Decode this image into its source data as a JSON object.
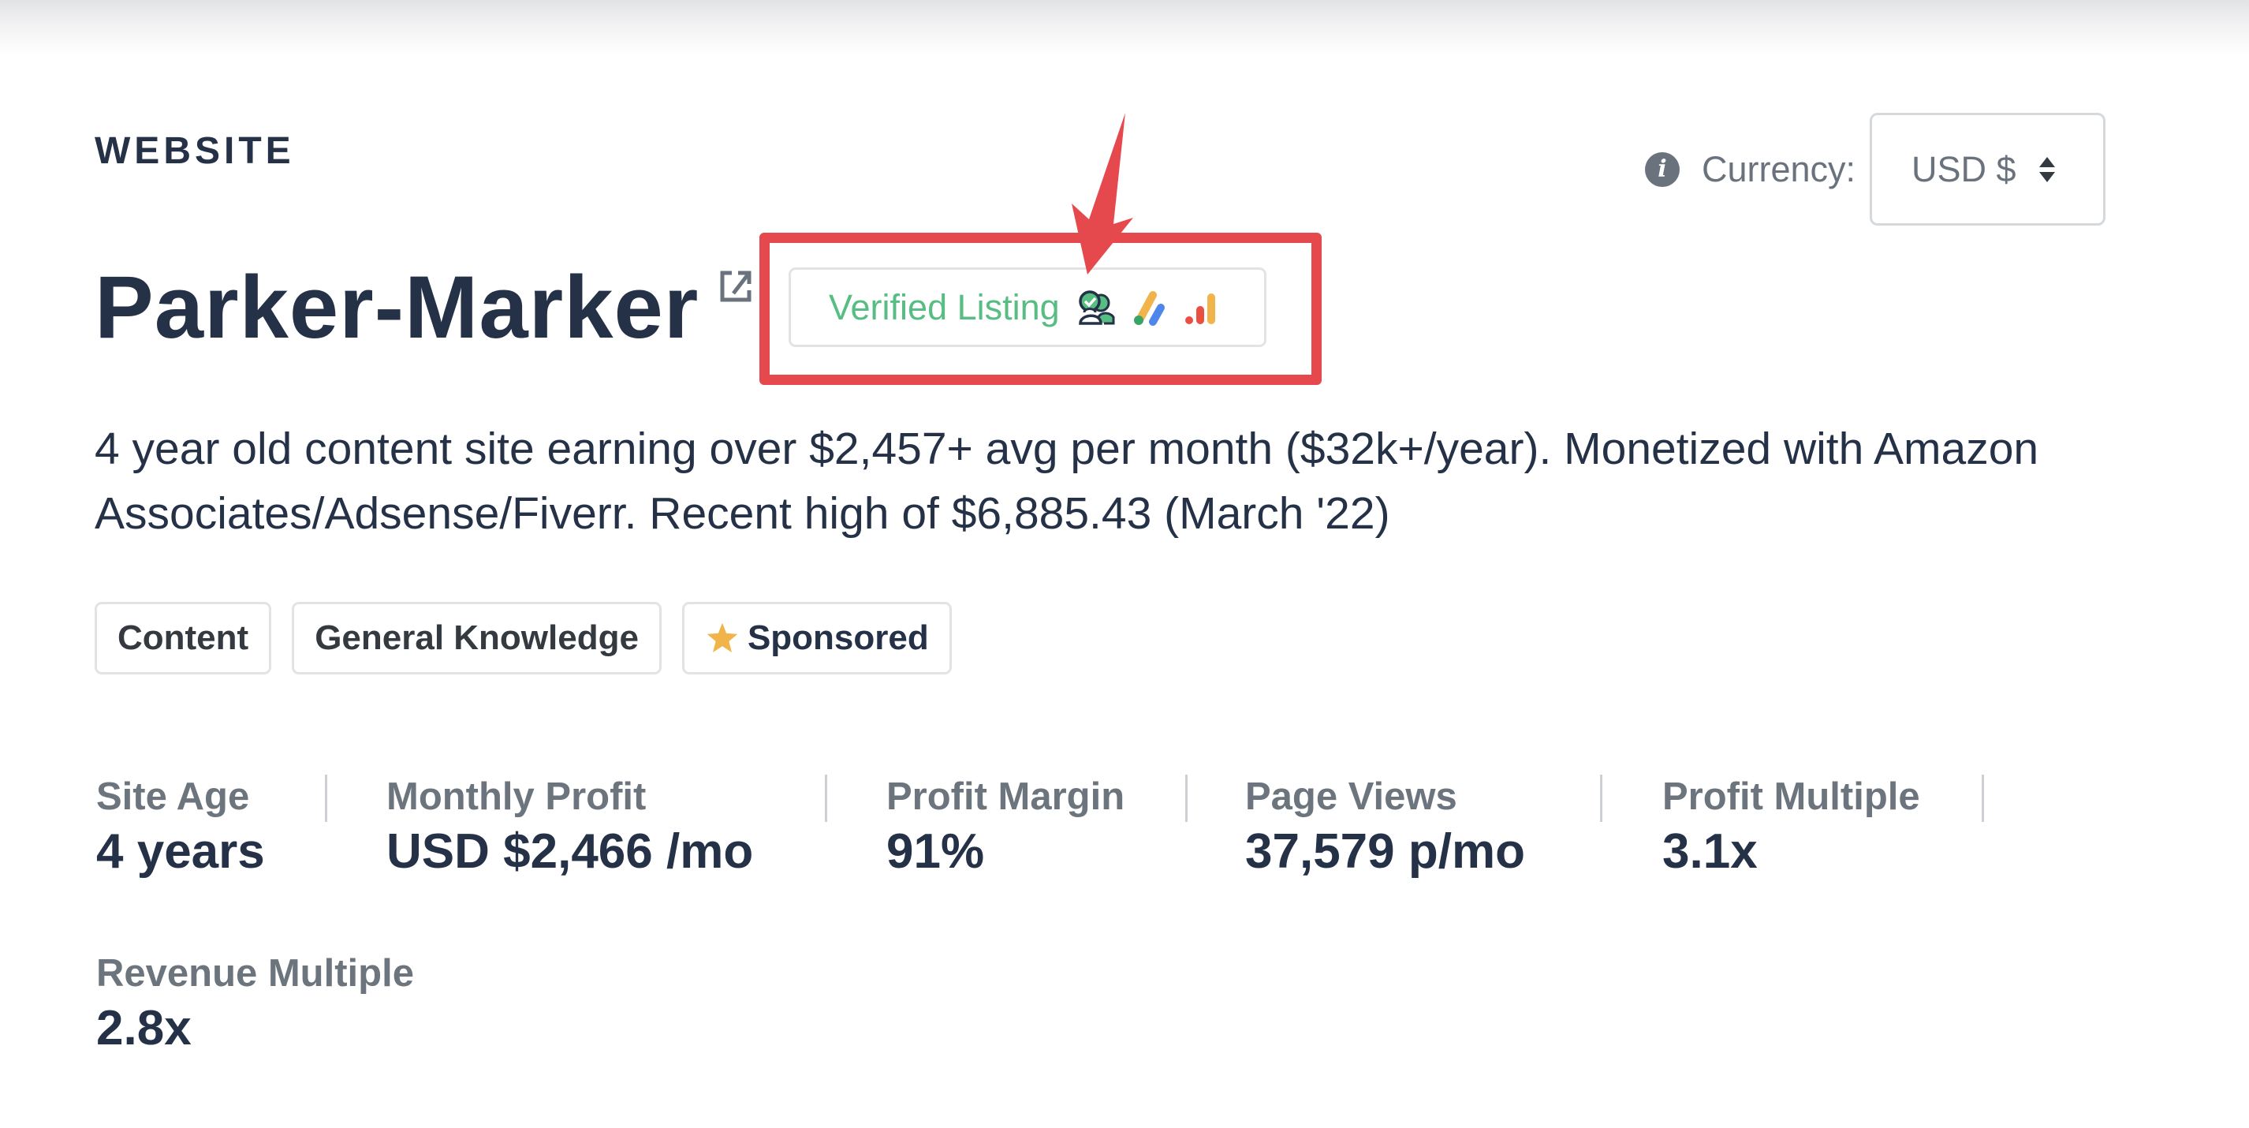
{
  "header": {
    "eyebrow": "WEBSITE",
    "currency_label": "Currency:",
    "currency_selected": "USD $"
  },
  "listing": {
    "title": "Parker-Marker",
    "verified_badge_label": "Verified Listing",
    "badge_icons": [
      "verified-user-icon",
      "google-adsense-icon",
      "google-analytics-icon"
    ],
    "description": "4 year old content site earning over $2,457+ avg per month ($32k+/year). Monetized with Amazon Associates/Adsense/Fiverr. Recent high of $6,885.43 (March '22)"
  },
  "tags": [
    {
      "label": "Content",
      "icon": null
    },
    {
      "label": "General Knowledge",
      "icon": null
    },
    {
      "label": "Sponsored",
      "icon": "star-icon"
    }
  ],
  "stats": [
    {
      "label": "Site Age",
      "value": "4 years"
    },
    {
      "label": "Monthly Profit",
      "value": "USD $2,466 /mo"
    },
    {
      "label": "Profit Margin",
      "value": "91%"
    },
    {
      "label": "Page Views",
      "value": "37,579 p/mo"
    },
    {
      "label": "Profit Multiple",
      "value": "3.1x"
    },
    {
      "label": "Revenue Multiple",
      "value": "2.8x"
    }
  ],
  "colors": {
    "primary_text": "#243147",
    "muted_text": "#6c757d",
    "verified_green": "#57bd82",
    "annotation_red": "#e5494d",
    "star_yellow": "#f0b44a"
  }
}
